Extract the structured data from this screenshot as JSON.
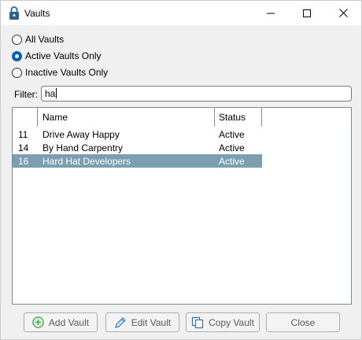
{
  "window": {
    "title": "Vaults"
  },
  "filter_options": [
    {
      "label": "All Vaults",
      "checked": false
    },
    {
      "label": "Active Vaults Only",
      "checked": true
    },
    {
      "label": "Inactive Vaults Only",
      "checked": false
    }
  ],
  "filter": {
    "label": "Filter:",
    "value": "ha"
  },
  "table": {
    "columns": {
      "id": "",
      "name": "Name",
      "status": "Status"
    },
    "rows": [
      {
        "id": "11",
        "name": "Drive Away Happy",
        "status": "Active",
        "selected": false
      },
      {
        "id": "14",
        "name": "By Hand Carpentry",
        "status": "Active",
        "selected": false
      },
      {
        "id": "16",
        "name": "Hard Hat Developers",
        "status": "Active",
        "selected": true
      }
    ]
  },
  "buttons": {
    "add": "Add Vault",
    "edit": "Edit Vault",
    "copy": "Copy Vault",
    "close": "Close"
  },
  "colors": {
    "selected_row": "#7b9fb1",
    "radio_accent": "#005fb8",
    "add_icon": "#4caf50",
    "edit_icon": "#2e82d0",
    "copy_icon": "#3a6fa0"
  },
  "icons": {
    "app": "padlock-icon",
    "add": "plus-circle-icon",
    "edit": "pencil-icon",
    "copy": "copy-icon"
  }
}
